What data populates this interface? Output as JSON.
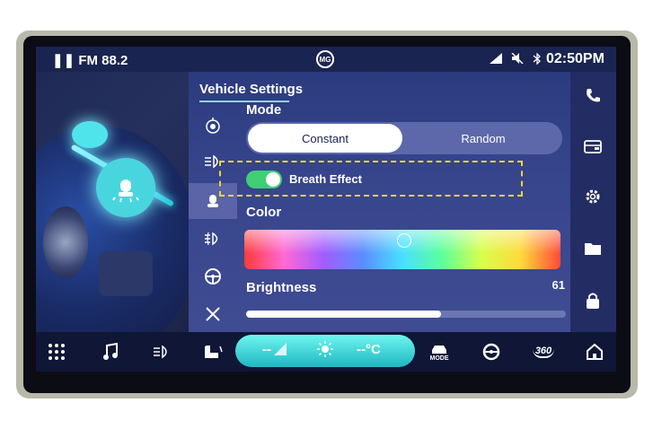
{
  "status_bar": {
    "pause_glyph": "❚❚",
    "radio": "FM 88.2",
    "logo": "MG",
    "clock": "02:50PM"
  },
  "panel": {
    "title": "Vehicle Settings",
    "mode_label": "Mode",
    "mode_options": [
      "Constant",
      "Random"
    ],
    "mode_selected": "Constant",
    "breath_label": "Breath Effect",
    "breath_on": true,
    "color_label": "Color",
    "brightness_label": "Brightness",
    "brightness_value": "61",
    "brightness_level": 0.61
  },
  "nav_icons": [
    "wheel-lamp-icon",
    "headlight-icon",
    "ambient-light-icon",
    "fog-light-icon",
    "steering-wheel-icon",
    "tools-icon"
  ],
  "right_icons": [
    "phone-icon",
    "wallet-icon",
    "settings-icon",
    "folder-icon",
    "lock-icon"
  ],
  "dock": {
    "fan_text": "--",
    "temp_text": "--°C",
    "mode_text": "MODE",
    "view_360": "360"
  },
  "colors": {
    "accent": "#3fcf75",
    "highlight_box": "#f2d437",
    "panel_bg": "#2c3a7e"
  }
}
